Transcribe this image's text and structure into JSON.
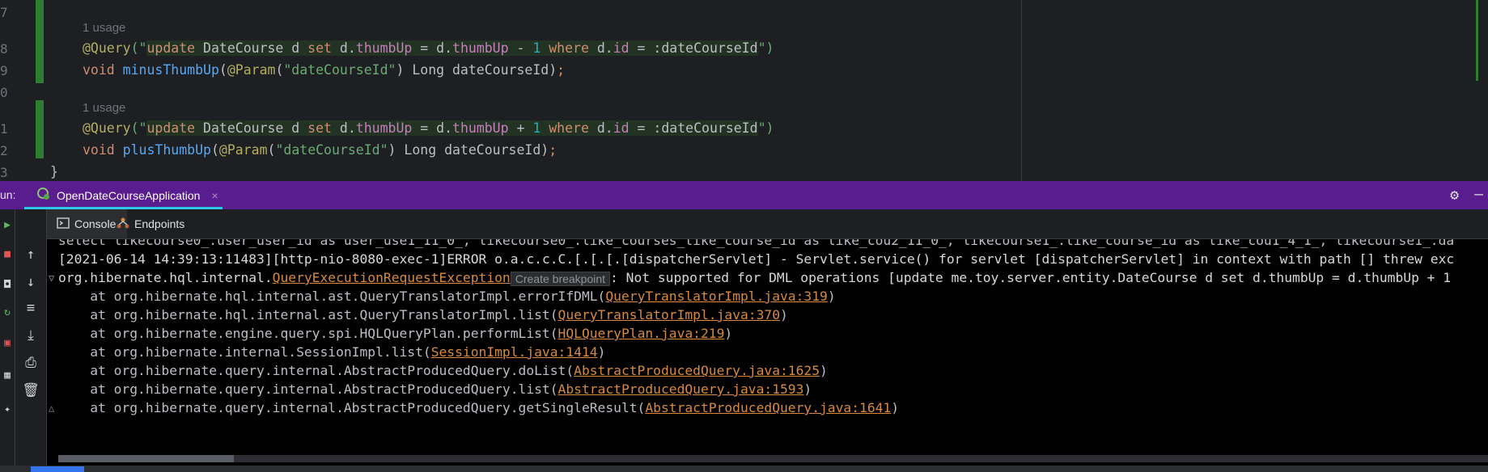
{
  "editor": {
    "line_numbers": [
      "7",
      "8",
      "9",
      "0",
      "1",
      "2",
      "3"
    ],
    "usage_hint_1": "1 usage",
    "usage_hint_2": "1 usage",
    "line8": {
      "annotation": "@Query",
      "open": "(\"",
      "q1": "update",
      "q2": " DateCourse d ",
      "q3": "set",
      "q4": " d.",
      "q5": "thumbUp",
      "q6": " = d.",
      "q7": "thumbUp",
      "q8": " - ",
      "q9": "1",
      "q10": " ",
      "q11": "where",
      "q12": " d.",
      "q13": "id",
      "q14": " = :dateCourseId",
      "close": "\")"
    },
    "line9": {
      "kw": "void",
      "fn": " minusThumbUp",
      "p1": "(",
      "ann": "@Param",
      "p2": "(",
      "str": "\"dateCourseId\"",
      "p3": ") Long dateCourseId)",
      "semi": ";"
    },
    "line11": {
      "annotation": "@Query",
      "open": "(\"",
      "q1": "update",
      "q2": " DateCourse d ",
      "q3": "set",
      "q4": " d.",
      "q5": "thumbUp",
      "q6": " = d.",
      "q7": "thumbUp",
      "q8": " + ",
      "q9": "1",
      "q10": " ",
      "q11": "where",
      "q12": " d.",
      "q13": "id",
      "q14": " = :dateCourseId",
      "close": "\")"
    },
    "line12": {
      "kw": "void",
      "fn": " plusThumbUp",
      "p1": "(",
      "ann": "@Param",
      "p2": "(",
      "str": "\"dateCourseId\"",
      "p3": ") Long dateCourseId)",
      "semi": ";"
    },
    "line13": "}"
  },
  "run_panel": {
    "label": "un:",
    "tab_title": "OpenDateCourseApplication",
    "tab_close": "×",
    "settings_icon": "gear-icon",
    "minimize_icon": "minimize-icon",
    "subtabs": {
      "console": "Console",
      "endpoints": "Endpoints"
    }
  },
  "console": {
    "line1": "select likecourse0_.user_user_id as user_use1_11_0_, likecourse0_.like_courses_like_course_id as like_cou2_11_0_, likecourse1_.like_course_id as like_cou1_4_1_, likecourse1_.da",
    "line2": "[2021-06-14 14:39:13:11483][http-nio-8080-exec-1]ERROR o.a.c.c.C.[.[.[.[dispatcherServlet] - Servlet.service() for servlet [dispatcherServlet] in context with path [] threw exc",
    "line3_prefix": "org.hibernate.hql.internal.",
    "line3_link": "QueryExecutionRequestException",
    "tooltip": "Create breakpoint",
    "line3_suffix": ": Not supported for DML operations [update me.toy.server.entity.DateCourse d set d.thumbUp = d.thumbUp + 1",
    "stack": [
      {
        "at": "    at org.hibernate.hql.internal.ast.QueryTranslatorImpl.errorIfDML(",
        "link": "QueryTranslatorImpl.java:319",
        "end": ")"
      },
      {
        "at": "    at org.hibernate.hql.internal.ast.QueryTranslatorImpl.list(",
        "link": "QueryTranslatorImpl.java:370",
        "end": ")"
      },
      {
        "at": "    at org.hibernate.engine.query.spi.HQLQueryPlan.performList(",
        "link": "HQLQueryPlan.java:219",
        "end": ")"
      },
      {
        "at": "    at org.hibernate.internal.SessionImpl.list(",
        "link": "SessionImpl.java:1414",
        "end": ")"
      },
      {
        "at": "    at org.hibernate.query.internal.AbstractProducedQuery.doList(",
        "link": "AbstractProducedQuery.java:1625",
        "end": ")"
      },
      {
        "at": "    at org.hibernate.query.internal.AbstractProducedQuery.list(",
        "link": "AbstractProducedQuery.java:1593",
        "end": ")"
      },
      {
        "at": "    at org.hibernate.query.internal.AbstractProducedQuery.getSingleResult(",
        "link": "AbstractProducedQuery.java:1641",
        "end": ")"
      }
    ]
  }
}
